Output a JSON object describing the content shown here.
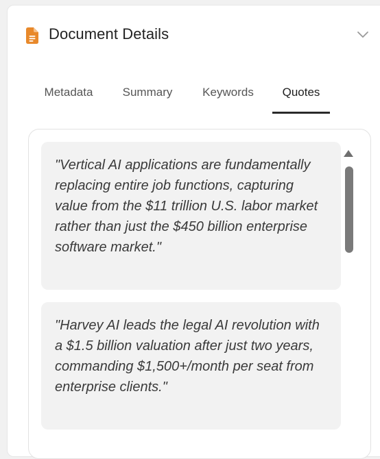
{
  "header": {
    "title": "Document Details",
    "icon": "document-icon",
    "icon_color": "#E8892B",
    "collapse_icon": "chevron-down-icon"
  },
  "tabs": [
    {
      "label": "Metadata",
      "active": false
    },
    {
      "label": "Summary",
      "active": false
    },
    {
      "label": "Keywords",
      "active": false
    },
    {
      "label": "Quotes",
      "active": true
    }
  ],
  "quotes": [
    {
      "text": "\"Vertical AI applications are fundamentally replacing entire job functions, capturing value from the $11 trillion U.S. labor market rather than just the $450 billion enterprise software market.\""
    },
    {
      "text": "\"Harvey AI leads the legal AI revolution with a $1.5 billion valuation after just two years, commanding $1,500+/month per seat from enterprise clients.\""
    }
  ],
  "colors": {
    "card_background": "#F2F2F2",
    "active_tab_underline": "#2A2A2A",
    "scrollbar_thumb": "#7A7A7A"
  }
}
